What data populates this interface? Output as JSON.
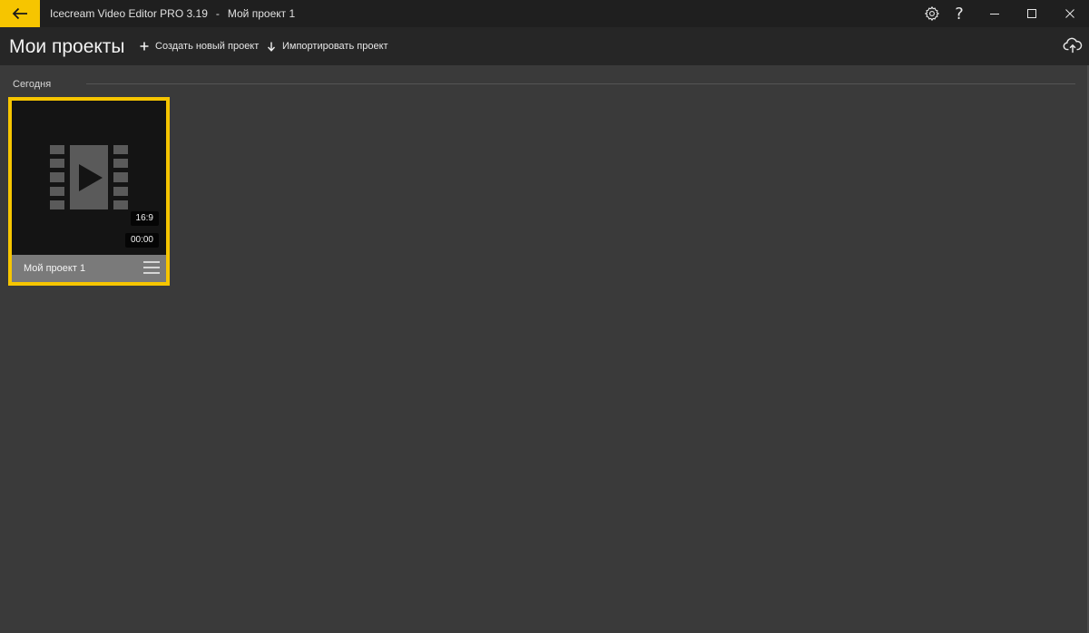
{
  "titlebar": {
    "app_name": "Icecream Video Editor PRO 3.19",
    "separator": "-",
    "project_name": "Мой проект 1",
    "icons": {
      "back": "arrow-left-icon",
      "settings": "gear-icon",
      "help": "question-icon",
      "minimize": "minimize-icon",
      "maximize": "maximize-icon",
      "close": "close-icon"
    },
    "help_label": "?"
  },
  "header": {
    "title": "Мои проекты",
    "create_label": "Создать новый проект",
    "import_label": "Импортировать проект",
    "icons": {
      "create": "plus-icon",
      "import": "arrow-down-icon",
      "cloud": "cloud-upload-icon"
    }
  },
  "section": {
    "label": "Сегодня"
  },
  "projects": [
    {
      "name": "Мой проект 1",
      "aspect": "16:9",
      "duration": "00:00",
      "icons": {
        "thumb": "film-play-icon",
        "menu": "hamburger-menu-icon"
      }
    }
  ],
  "colors": {
    "accent": "#f6c500",
    "background": "#3a3a3a",
    "titlebar": "#1f1f1f",
    "header": "#262626",
    "card_footer": "#7a7a7a"
  }
}
